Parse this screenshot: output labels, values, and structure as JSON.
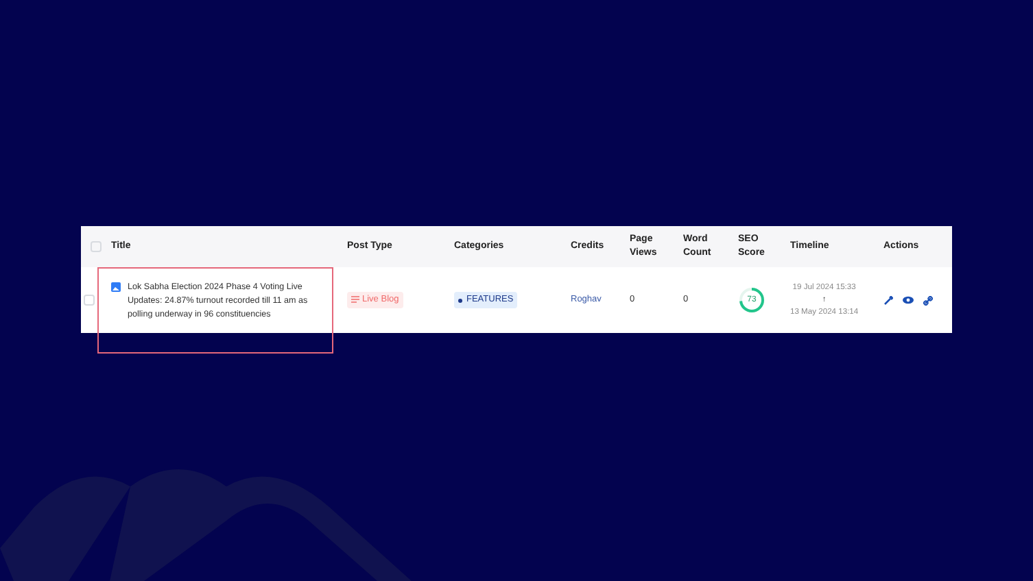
{
  "table": {
    "columns": [
      "Title",
      "Post Type",
      "Categories",
      "Credits",
      "Page Views",
      "Word Count",
      "SEO Score",
      "Timeline",
      "Actions"
    ],
    "select_all": {
      "checked": false
    },
    "rows": [
      {
        "checked": false,
        "title": "Lok Sabha Election 2024 Phase 4 Voting Live Updates: 24.87% turnout recorded till 11 am as polling underway in 96 constituencies",
        "post_type": "Live Blog",
        "category": "FEATURES",
        "credits": "Roghav",
        "page_views": "0",
        "word_count": "0",
        "seo_score": "73",
        "seo": {
          "level": 0.73
        },
        "timeline_updated": "19 Jul 2024 15:33",
        "timeline_arrow": "↑",
        "timeline_created": "13 May 2024 13:14",
        "highlighted": true
      }
    ]
  }
}
